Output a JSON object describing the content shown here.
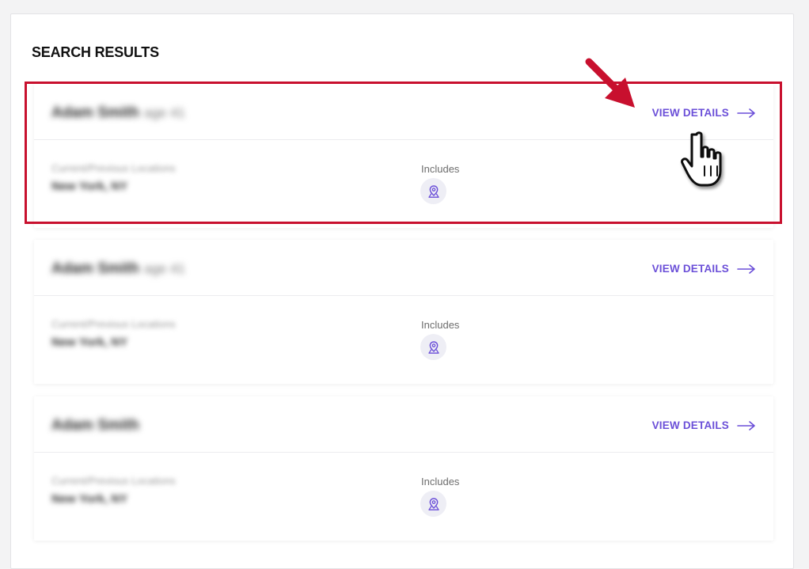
{
  "page": {
    "title": "SEARCH RESULTS"
  },
  "results": [
    {
      "name": "Adam Smith",
      "age": "age 41",
      "location_label": "Current/Previous Locations",
      "location": "New York, NY",
      "includes_label": "Includes",
      "view_details_label": "VIEW DETAILS",
      "includes_icon": "location-pin-icon"
    },
    {
      "name": "Adam Smith",
      "age": "age 41",
      "location_label": "Current/Previous Locations",
      "location": "New York, NY",
      "includes_label": "Includes",
      "view_details_label": "VIEW DETAILS",
      "includes_icon": "location-pin-icon"
    },
    {
      "name": "Adam Smith",
      "age": "",
      "location_label": "Current/Previous Locations",
      "location": "New York, NY",
      "includes_label": "Includes",
      "view_details_label": "VIEW DETAILS",
      "includes_icon": "location-pin-icon"
    }
  ],
  "colors": {
    "accent": "#6b4fd8",
    "highlight": "#c8102e"
  }
}
